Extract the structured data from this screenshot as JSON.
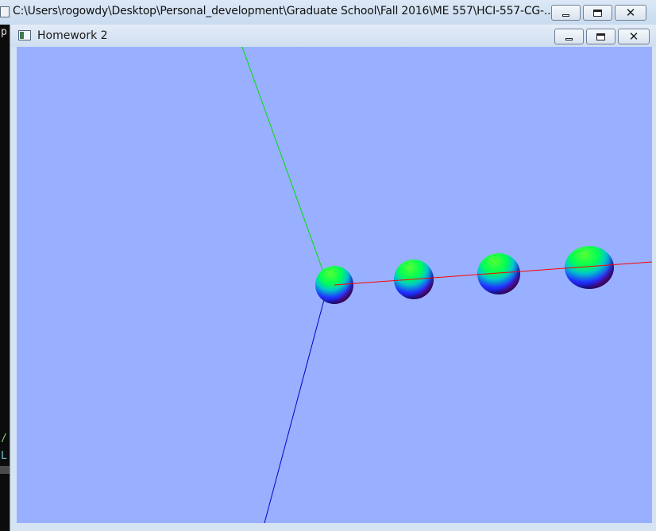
{
  "console_window": {
    "title": "C:\\Users\\rogowdy\\Desktop\\Personal_development\\Graduate School\\Fall 2016\\ME 557\\HCI-557-CG-...",
    "icon": "console-app-icon",
    "left_edge_chars": [
      "p",
      "/",
      "L"
    ],
    "controls": {
      "minimize": "minimize-icon",
      "maximize": "maximize-icon",
      "close": "close-icon"
    }
  },
  "gl_window": {
    "title": "Homework 2",
    "icon": "gl-window-app-icon",
    "controls": {
      "minimize": "minimize-icon",
      "maximize": "maximize-icon",
      "close": "close-icon"
    },
    "scene": {
      "background_color": "#98b0ff",
      "axes": [
        {
          "name": "x-axis",
          "color": "#ff0000"
        },
        {
          "name": "y-axis",
          "color": "#00dd00"
        },
        {
          "name": "z-axis",
          "color": "#0000cc"
        }
      ],
      "sphere_count": 4,
      "sphere_colors": [
        "#00ff00",
        "#0000ff",
        "#ff00ff",
        "#000000"
      ]
    }
  }
}
